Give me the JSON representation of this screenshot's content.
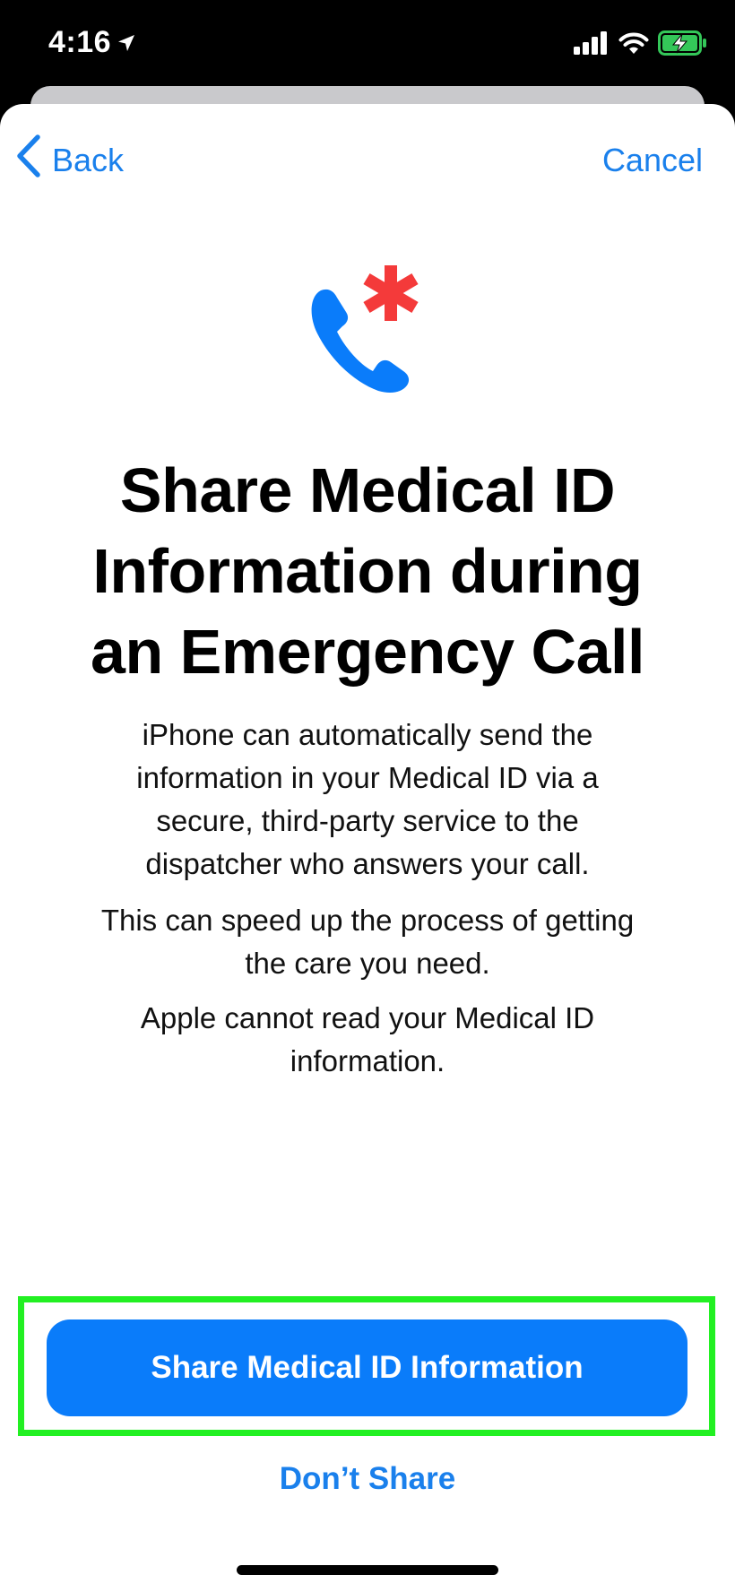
{
  "status_bar": {
    "time": "4:16",
    "location_icon": "location-arrow-icon",
    "signal_icon": "cellular-signal-icon",
    "wifi_icon": "wifi-icon",
    "battery_icon": "battery-charging-icon",
    "battery_color": "#34c759"
  },
  "nav": {
    "back_label": "Back",
    "cancel_label": "Cancel",
    "back_icon": "chevron-left-icon"
  },
  "hero": {
    "icon": "emergency-phone-icon",
    "phone_color": "#0a7cfa",
    "asterisk_color": "#f43a3a"
  },
  "title": {
    "line1": "Share Medical ID",
    "line2": "Information during",
    "line3": "an Emergency Call"
  },
  "body": {
    "p1": {
      "line1": "iPhone can automatically send the",
      "line2": "information in your Medical ID via a",
      "line3": "secure, third-party service to the",
      "line4": "dispatcher who answers your call."
    },
    "p2": {
      "line1": "This can speed up the process of getting",
      "line2": "the care you need."
    },
    "p3": {
      "line1": "Apple cannot read your Medical ID",
      "line2": "information."
    }
  },
  "actions": {
    "primary_label": "Share Medical ID Information",
    "secondary_label": "Don’t Share",
    "accent_color": "#0a7cfa",
    "highlight_color": "#22f022"
  }
}
